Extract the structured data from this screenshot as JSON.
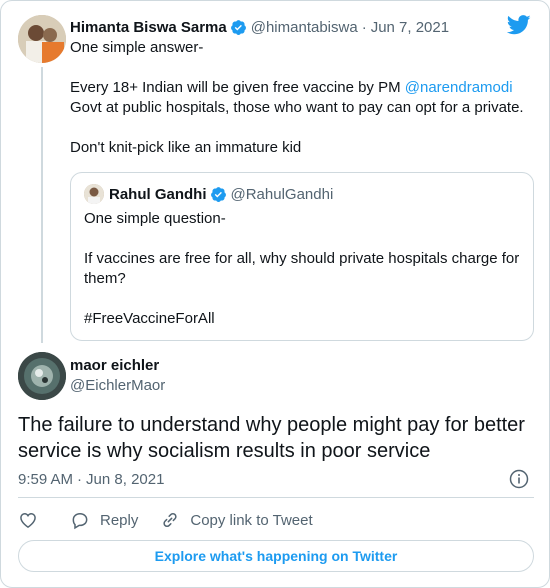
{
  "parent_tweet": {
    "name": "Himanta Biswa Sarma",
    "handle": "@himantabiswa",
    "separator": "·",
    "date": "Jun 7, 2021",
    "line1": "One simple answer-",
    "line2_prefix": "Every 18+ Indian will be given free vaccine by PM ",
    "line2_mention": "@narendramodi",
    "line3": "Govt at public  hospitals, those who want to pay can opt for a private.",
    "line4": "Don't knit-pick like an immature kid"
  },
  "quoted_tweet": {
    "name": "Rahul Gandhi",
    "handle": "@RahulGandhi",
    "line1": "One simple question-",
    "line2": "If vaccines are free for all, why should private hospitals charge for them?",
    "line3": "#FreeVaccineForAll"
  },
  "reply_tweet": {
    "name": "maor eichler",
    "handle": "@EichlerMaor",
    "text": "The failure to understand why people might pay for better service is why socialism results in poor service",
    "time": "9:59 AM",
    "separator": "·",
    "date": "Jun 8, 2021"
  },
  "actions": {
    "reply_label": "Reply",
    "copy_link_label": "Copy link to Tweet"
  },
  "explore_label": "Explore what's happening on Twitter",
  "icons": {
    "verified": "verified-badge-icon",
    "brand": "twitter-bird-icon",
    "info": "info-icon",
    "like": "heart-icon",
    "reply": "speech-bubble-icon",
    "copy_link": "link-icon"
  },
  "colors": {
    "accent": "#1d9bf0",
    "text": "#0f1419",
    "secondary": "#536471",
    "border": "#cfd9de"
  }
}
